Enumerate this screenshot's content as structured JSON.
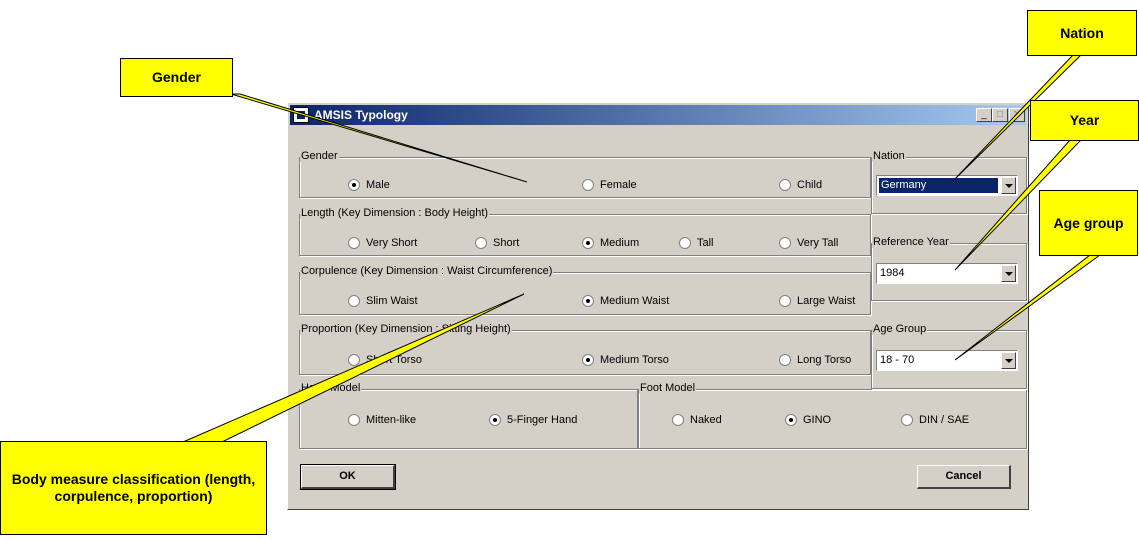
{
  "window": {
    "title": "AMSIS Typology",
    "controls": {
      "minimize": "_",
      "maximize": "□",
      "close": "✕"
    }
  },
  "groups": {
    "gender": {
      "label": "Gender",
      "options": [
        "Male",
        "Female",
        "Child"
      ],
      "selected": "Male"
    },
    "length": {
      "label": "Length (Key Dimension : Body Height)",
      "options": [
        "Very Short",
        "Short",
        "Medium",
        "Tall",
        "Very Tall"
      ],
      "selected": "Medium"
    },
    "corpulence": {
      "label": "Corpulence (Key Dimension : Waist Circumference)",
      "options": [
        "Slim Waist",
        "Medium Waist",
        "Large Waist"
      ],
      "selected": "Medium Waist"
    },
    "proportion": {
      "label": "Proportion (Key Dimension : Sitting Height)",
      "options": [
        "Short Torso",
        "Medium Torso",
        "Long Torso"
      ],
      "selected": "Medium Torso"
    },
    "hand": {
      "label": "Hand Model",
      "options": [
        "Mitten-like",
        "5-Finger Hand"
      ],
      "selected": "5-Finger Hand"
    },
    "foot": {
      "label": "Foot Model",
      "options": [
        "Naked",
        "GINO",
        "DIN / SAE"
      ],
      "selected": "GINO"
    },
    "nation": {
      "label": "Nation",
      "value": "Germany"
    },
    "reference_year": {
      "label": "Reference Year",
      "value": "1984"
    },
    "age_group": {
      "label": "Age Group",
      "value": "18 - 70"
    }
  },
  "buttons": {
    "ok": "OK",
    "cancel": "Cancel"
  },
  "callouts": {
    "gender": "Gender",
    "nation": "Nation",
    "year": "Year",
    "age_group": "Age group",
    "body_measure": "Body measure classification (length, corpulence, proportion)"
  },
  "colors": {
    "callout": "#ffff00",
    "titlebar_start": "#0a246a",
    "titlebar_end": "#a6caf0",
    "dialog": "#d4d0c8"
  }
}
